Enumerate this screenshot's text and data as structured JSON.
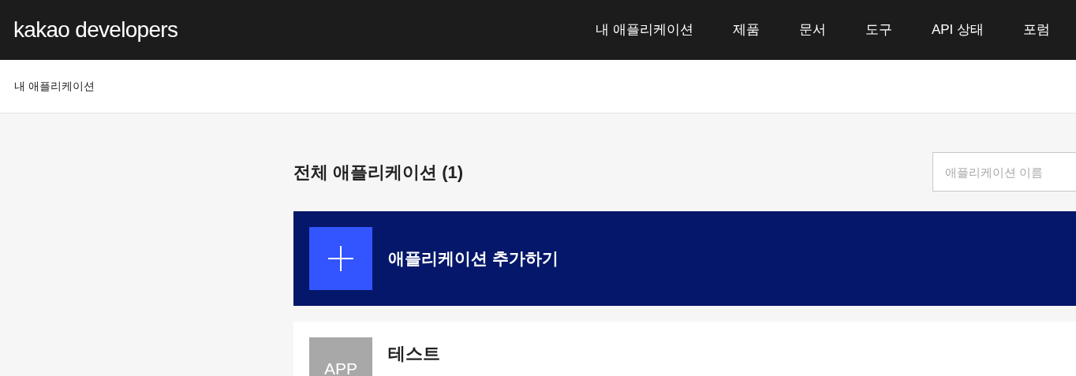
{
  "header": {
    "logo": "kakao developers",
    "nav": [
      "내 애플리케이션",
      "제품",
      "문서",
      "도구",
      "API 상태",
      "포럼"
    ]
  },
  "breadcrumb": "내 애플리케이션",
  "title": "전체 애플리케이션 (1)",
  "search": {
    "placeholder": "애플리케이션 이름"
  },
  "add_button": {
    "label": "애플리케이션 추가하기"
  },
  "apps": [
    {
      "thumbnail": "APP",
      "name": "테스트"
    }
  ]
}
